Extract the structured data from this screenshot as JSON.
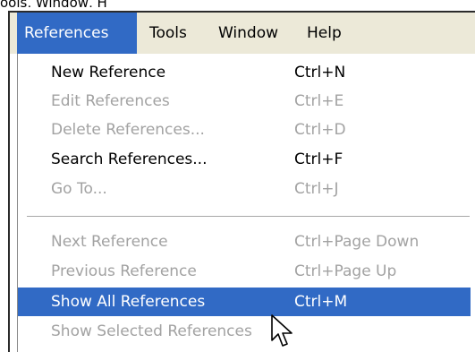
{
  "top_fragment": "ools, Window, H",
  "menubar": {
    "items": [
      {
        "label": "References",
        "active": true
      },
      {
        "label": "Tools",
        "active": false
      },
      {
        "label": "Window",
        "active": false
      },
      {
        "label": "Help",
        "active": false
      }
    ]
  },
  "menu": {
    "items": [
      {
        "label": "New Reference",
        "shortcut": "Ctrl+N",
        "state": "enabled"
      },
      {
        "label": "Edit References",
        "shortcut": "Ctrl+E",
        "state": "disabled"
      },
      {
        "label": "Delete References...",
        "shortcut": "Ctrl+D",
        "state": "disabled"
      },
      {
        "label": "Search References...",
        "shortcut": "Ctrl+F",
        "state": "enabled"
      },
      {
        "label": "Go To...",
        "shortcut": "Ctrl+J",
        "state": "disabled"
      },
      {
        "label": "Next Reference",
        "shortcut": "Ctrl+Page Down",
        "state": "disabled"
      },
      {
        "label": "Previous Reference",
        "shortcut": "Ctrl+Page Up",
        "state": "disabled"
      },
      {
        "label": "Show All References",
        "shortcut": "Ctrl+M",
        "state": "highlighted"
      },
      {
        "label": "Show Selected References",
        "shortcut": "",
        "state": "disabled"
      }
    ]
  },
  "colors": {
    "highlight": "#316ac5",
    "menubar_bg": "#ece9d8",
    "disabled_text": "#a2a2a2"
  },
  "icons": {
    "cursor": "mouse-pointer-icon"
  }
}
